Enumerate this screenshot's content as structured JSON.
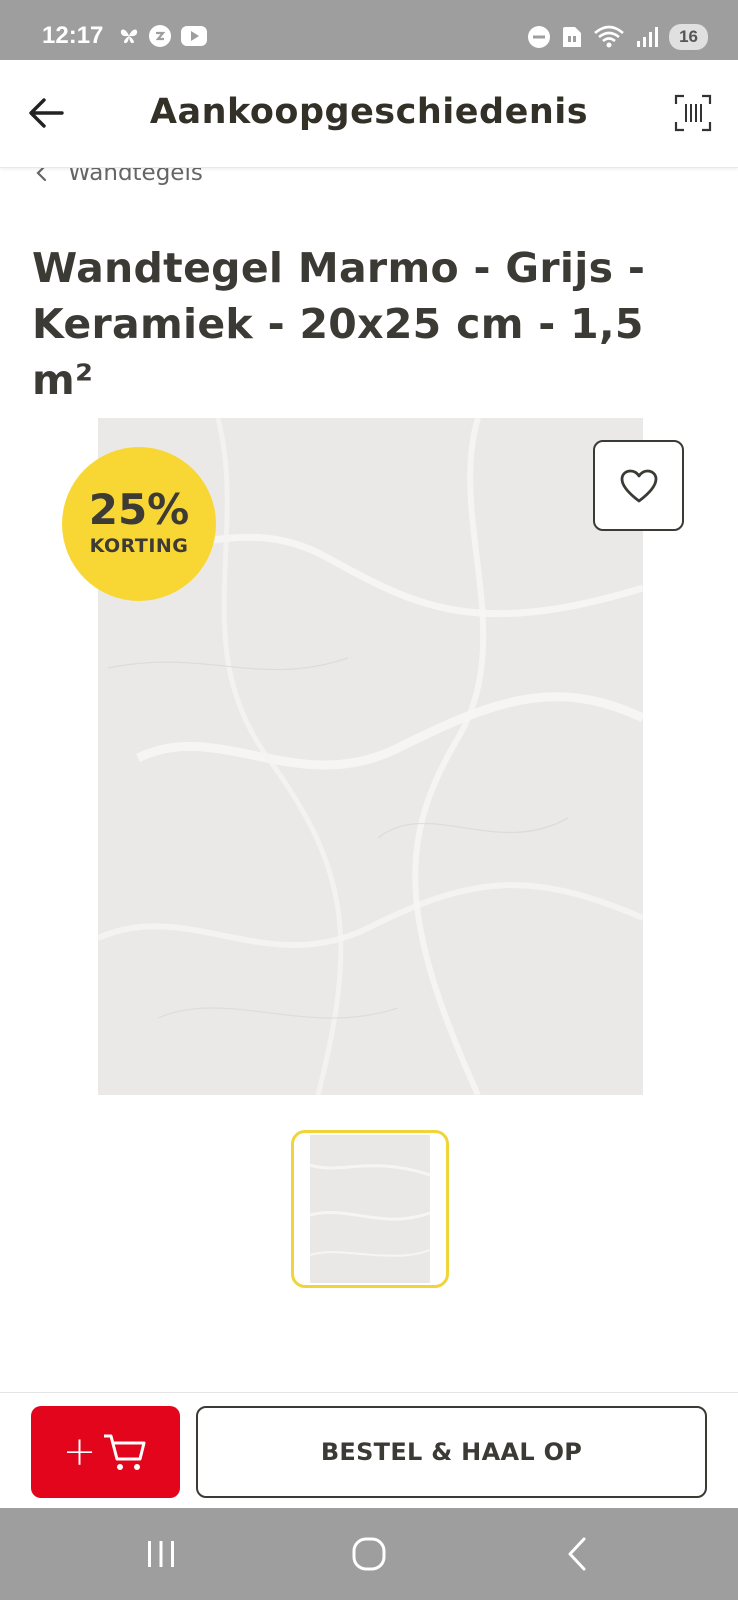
{
  "status_bar": {
    "time": "12:17",
    "battery": "16",
    "left_icons": [
      "butterfly-icon",
      "sync-icon",
      "youtube-icon"
    ],
    "right_icons": [
      "dnd-icon",
      "sim-icon",
      "wifi-icon",
      "signal-icon"
    ]
  },
  "header": {
    "title": "Aankoopgeschiedenis",
    "back_icon": "arrow-left-icon",
    "scan_icon": "barcode-scan-icon"
  },
  "breadcrumb": {
    "label": "Wandtegels",
    "icon": "chevron-left-icon"
  },
  "product": {
    "title": "Wandtegel Marmo - Grijs - Keramiek - 20x25 cm - 1,5 m²",
    "discount_percent": "25%",
    "discount_label": "KORTING",
    "favorite_icon": "heart-icon"
  },
  "actions": {
    "add_to_cart_label": "+",
    "add_to_cart_icon": "cart-icon",
    "order_label": "BESTEL & HAAL OP"
  },
  "colors": {
    "accent_red": "#e3051b",
    "badge_yellow": "#f8d735",
    "text_dark": "#3b3a35"
  }
}
